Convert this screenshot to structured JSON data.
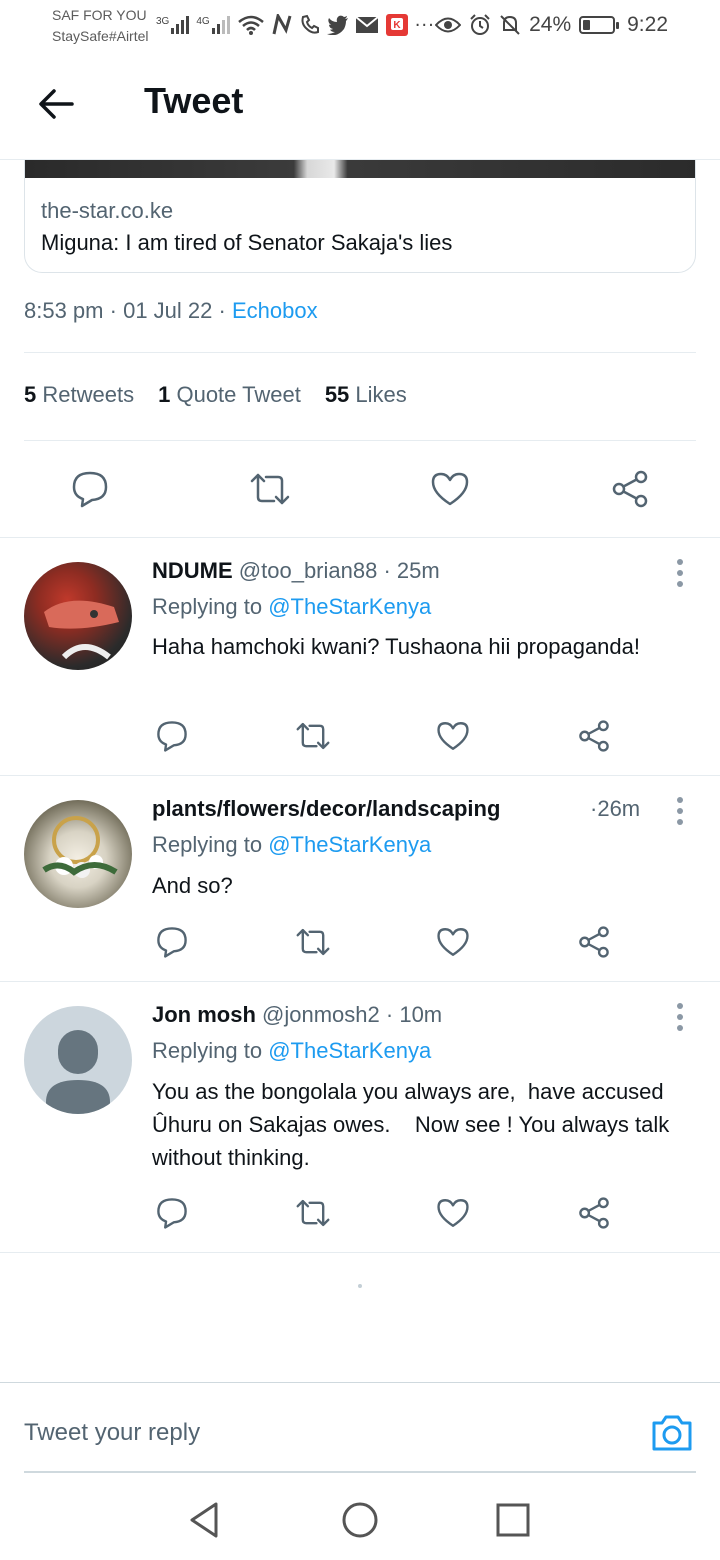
{
  "status_bar": {
    "carrier_line1": "SAF FOR YOU",
    "carrier_line2": "StaySafe#Airtel",
    "net1": "3G",
    "net2": "4G",
    "battery": "24%",
    "battery_level": 0.24,
    "time": "9:22"
  },
  "header": {
    "title": "Tweet"
  },
  "link_card": {
    "domain": "the-star.co.ke",
    "headline": "Miguna: I am tired of Senator Sakaja's lies"
  },
  "tweet_meta": {
    "time": "8:53 pm",
    "date": "01 Jul 22",
    "source": "Echobox",
    "sep": "·"
  },
  "stats": {
    "retweets_count": "5",
    "retweets_label": "Retweets",
    "quotes_count": "1",
    "quotes_label": "Quote Tweet",
    "likes_count": "55",
    "likes_label": "Likes"
  },
  "replies": [
    {
      "name": "NDUME",
      "handle": "@too_brian88",
      "age": "25m",
      "replying_prefix": "Replying to",
      "replying_to": "@TheStarKenya",
      "text": "Haha hamchoki kwani? Tushaona hii propaganda!"
    },
    {
      "name": "plants/flowers/decor/landscaping",
      "handle": "",
      "age": "26m",
      "replying_prefix": "Replying to",
      "replying_to": "@TheStarKenya",
      "text": "And so?"
    },
    {
      "name": "Jon mosh",
      "handle": "@jonmosh2",
      "age": "10m",
      "replying_prefix": "Replying to",
      "replying_to": "@TheStarKenya",
      "text": "You as the bongolala you always are,  have accused Ûhuru on Sakajas owes.    Now see ! You always talk without thinking."
    }
  ],
  "composer": {
    "placeholder": "Tweet your reply"
  },
  "colors": {
    "link": "#1d9bf0",
    "secondary": "#536471",
    "primary": "#0f1419"
  }
}
